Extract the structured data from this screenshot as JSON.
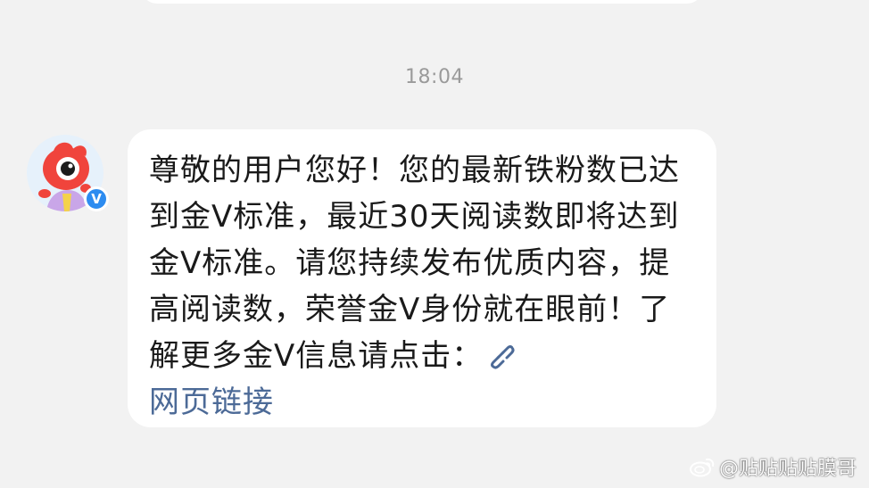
{
  "chat": {
    "timestamp": "18:04",
    "sender": {
      "avatar_icon": "weibo-mascot-avatar",
      "badge": "V"
    },
    "message": {
      "text": "尊敬的用户您好！您的最新铁粉数已达到金V标准，最近30天阅读数即将达到金V标准。请您持续发布优质内容，提高阅读数，荣誉金V身份就在眼前！了解更多金V信息请点击：",
      "link_icon": "link-icon",
      "link_label": "网页链接"
    }
  },
  "watermark": {
    "icon": "weibo-icon",
    "text": "@贴贴贴贴膜哥"
  },
  "colors": {
    "background": "#f2f2f2",
    "bubble": "#ffffff",
    "text": "#1a1a1a",
    "link": "#4c6a97",
    "timestamp": "#9a9a9a",
    "verified": "#2d8cf0",
    "mascot": "#f0443c"
  }
}
